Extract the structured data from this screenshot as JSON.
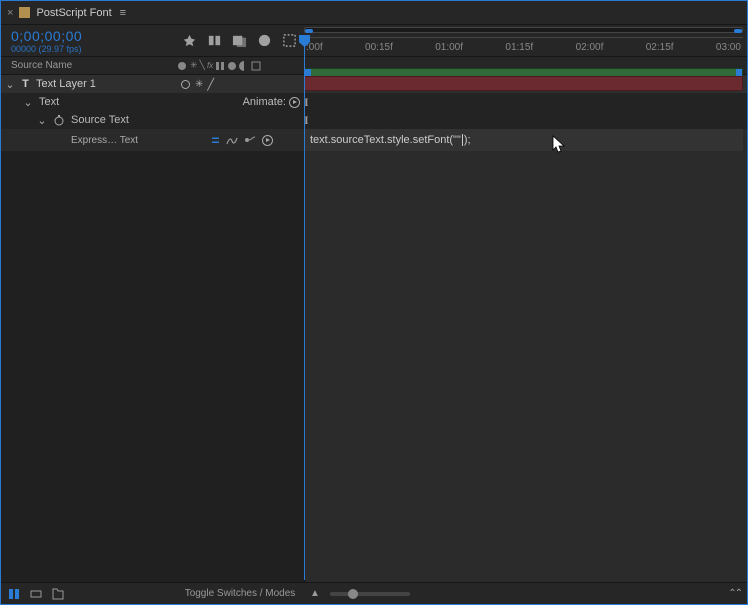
{
  "tab": {
    "title": "PostScript Font",
    "close": "×",
    "menu": "≡"
  },
  "timecode": {
    "value": "0;00;00;00",
    "sub": "00000 (29.97 fps)"
  },
  "columns": {
    "sourceName": "Source Name",
    "switches": "⊕ ✳ ╲ fx 🎬 ◐ ◑ ⊡"
  },
  "ruler": {
    "ticks": [
      ":00f",
      "00:15f",
      "01:00f",
      "01:15f",
      "02:00f",
      "02:15f",
      "03:00"
    ]
  },
  "layer": {
    "name": "Text Layer 1",
    "switches": "⊕ ✳ ╱"
  },
  "props": {
    "text": "Text",
    "animate": "Animate:",
    "sourceText": "Source Text",
    "expressionLabel": "Express… Text"
  },
  "expression": {
    "pre": "text.sourceText.style.setFont(\"\"",
    "post": ");"
  },
  "footer": {
    "toggle": "Toggle Switches / Modes",
    "mountains": "⌃⌃"
  }
}
